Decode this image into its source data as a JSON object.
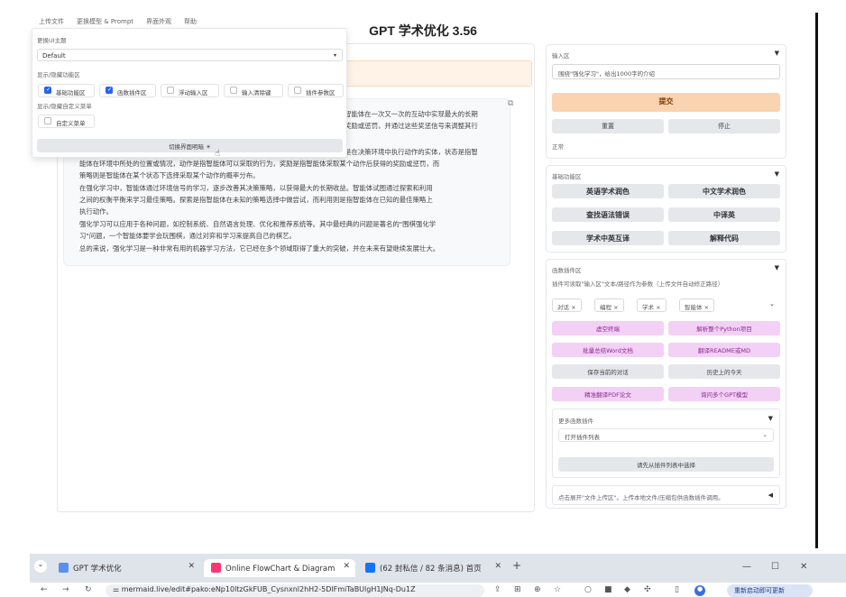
{
  "menu": [
    "上传文件",
    "更换模型 & Prompt",
    "界面外观",
    "帮助"
  ],
  "app_title": "GPT 学术优化 3.56",
  "chat": {
    "lines": [
      "智能体在一次又一次的互动中实现最大的长期",
      "奖励或惩罚，并通过这些奖惩信号来调整其行",
      "是在决策环境中执行动作的实体，状态是指智",
      "能体在环境中所处的位置或情况，动作是指智能体可以采取的行为，奖励是指智能体采取某个动作后获得的奖励或惩罚，而",
      "策略则是智能体在某个状态下选择采取某个动作的概率分布。",
      "在强化学习中，智能体通过环境信号的学习，逐步改善其决策策略，以获得最大的长期收益。智能体试图通过探索和利用",
      "之间的权衡平衡来学习最佳策略。探索是指智能体在未知的策略选择中做尝试，而利用则是指智能体在已知的最佳策略上",
      "执行动作。",
      "强化学习可以应用于各种问题，如控制系统、自然语言处理、优化和推荐系统等。其中最经典的问题是著名的\"围棋强化学",
      "习\"问题，一个智能体要学会玩围棋，通过对弈和学习来提高自己的棋艺。",
      "总的来说，强化学习是一种非常有用的机器学习方法，它已经在多个领域取得了重大的突破，并在未来有望继续发展壮大。"
    ]
  },
  "overlay": {
    "theme_label": "更换UI主题",
    "theme_value": "Default",
    "areas_label": "显示/隐藏功能区",
    "checkboxes": [
      {
        "label": "基础功能区",
        "checked": true
      },
      {
        "label": "函数插件区",
        "checked": true
      },
      {
        "label": "浮动输入区",
        "checked": false
      },
      {
        "label": "输入清除键",
        "checked": false
      },
      {
        "label": "插件参数区",
        "checked": false
      }
    ],
    "custom_label": "显示/隐藏自定义菜单",
    "custom_checkbox": {
      "label": "自定义菜单",
      "checked": false
    },
    "switch_button": "切换界面明暗 ☀"
  },
  "input_panel": {
    "title": "输入区",
    "toggle": "▼",
    "input_value": "围绕\"强化学习\"，给出1000字的介绍",
    "submit": "提交",
    "reset": "重置",
    "stop": "停止",
    "status": "正常"
  },
  "basic_panel": {
    "title": "基础功能区",
    "toggle": "▼",
    "buttons": [
      "英语学术润色",
      "中文学术润色",
      "查找语法错误",
      "中译英",
      "学术中英互译",
      "解释代码"
    ]
  },
  "plugin_panel": {
    "title": "函数插件区",
    "toggle": "▼",
    "hint": "插件可读取\"输入区\"文本/路径作为参数（上传文件自动修正路径）",
    "tags": [
      "对话 ×",
      "编程 ×",
      "学术 ×",
      "智能体 ×"
    ],
    "tags_caret": "⌄",
    "buttons": [
      {
        "label": "虚空终端",
        "style": "pink"
      },
      {
        "label": "解析整个Python项目",
        "style": "pink"
      },
      {
        "label": "批量总结Word文档",
        "style": "pink"
      },
      {
        "label": "翻译README或MD",
        "style": "pink"
      },
      {
        "label": "保存当前的对话",
        "style": "gray"
      },
      {
        "label": "历史上的今天",
        "style": "gray"
      },
      {
        "label": "精准翻译PDF论文",
        "style": "pink"
      },
      {
        "label": "询问多个GPT模型",
        "style": "pink"
      }
    ],
    "more_title": "更多函数插件",
    "more_toggle": "▼",
    "more_select": "打开插件列表",
    "more_caret": "⌄",
    "select_button": "请先从插件列表中选择",
    "upload_hint": "点击展开\"文件上传区\"。上传本地文件/压缩包供函数插件调用。",
    "upload_toggle": "◀"
  },
  "browser": {
    "tabs": [
      {
        "label": "GPT 学术优化",
        "active": false,
        "color": "#5b8ff0"
      },
      {
        "label": "Online FlowChart & Diagram",
        "active": true,
        "color": "#ff3670"
      },
      {
        "label": "(62 封私信 / 82 条消息) 首页",
        "active": false,
        "color": "#1772f6"
      }
    ],
    "new_tab": "+",
    "url": "mermaid.live/edit#pako:eNp10ltzGkFUB_Cysnxnl2hH2-5DlFmiTaBUlgH1JNq-Du1Z",
    "update_button": "重新启动即可更新",
    "controls": {
      "minimize": "—",
      "maximize": "☐",
      "close": "✕"
    }
  }
}
